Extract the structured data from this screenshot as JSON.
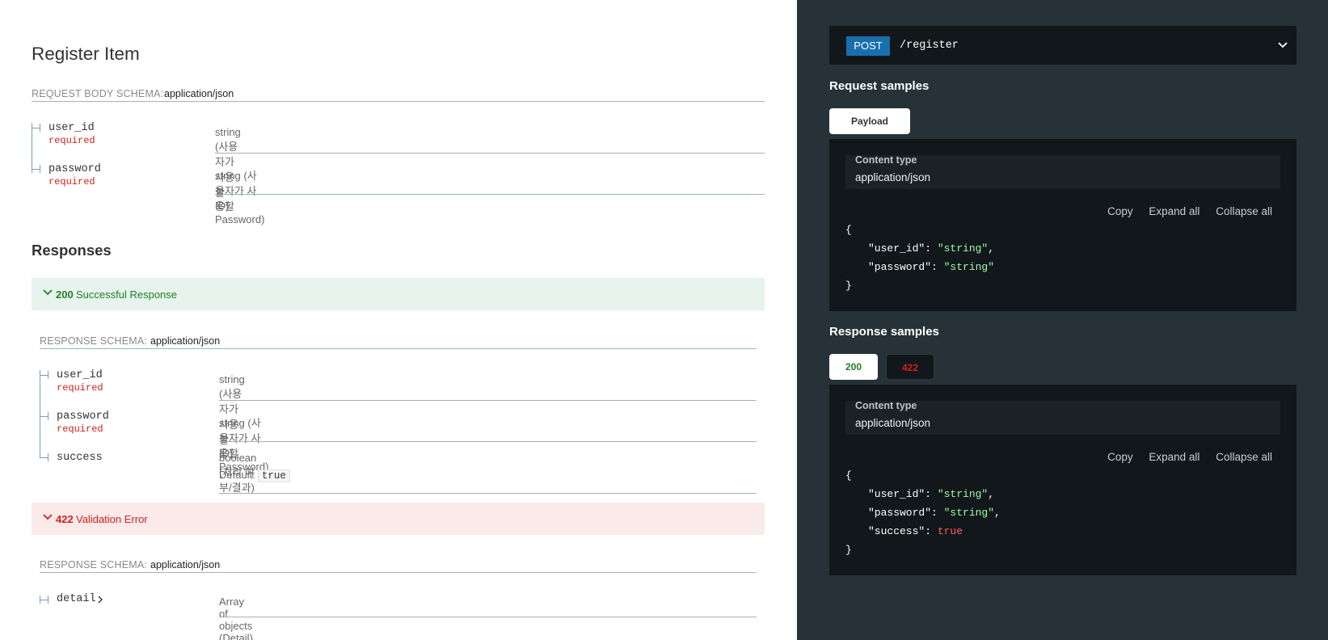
{
  "operation": {
    "title": "Register Item",
    "request_schema_label": "REQUEST BODY SCHEMA:",
    "request_schema_type": "application/json",
    "request_props": [
      {
        "name": "user_id",
        "required": "required",
        "desc": "string (사용자가 사용할 ID)"
      },
      {
        "name": "password",
        "required": "required",
        "desc": "string (사용자가 사용할 Password)"
      }
    ]
  },
  "responses": {
    "heading": "Responses",
    "ok": {
      "code": "200",
      "label": "Successful Response",
      "schema_label": "RESPONSE SCHEMA:",
      "schema_type": "application/json",
      "props": [
        {
          "name": "user_id",
          "required": "required",
          "desc": "string (사용자가 사용할 ID)"
        },
        {
          "name": "password",
          "required": "required",
          "desc": "string (사용자가 사용할 Password)"
        },
        {
          "name": "success",
          "desc": "boolean (처리 여부/결과)",
          "default_label": "Default:",
          "default_value": "true"
        }
      ]
    },
    "err": {
      "code": "422",
      "label": "Validation Error",
      "schema_label": "RESPONSE SCHEMA:",
      "schema_type": "application/json",
      "props": [
        {
          "name": "detail",
          "desc": "Array of objects (Detail)"
        }
      ]
    }
  },
  "panel": {
    "method": "POST",
    "path": "/register",
    "request_samples_title": "Request samples",
    "payload_tab": "Payload",
    "content_type_label": "Content type",
    "content_type_value": "application/json",
    "copy": "Copy",
    "expand_all": "Expand all",
    "collapse_all": "Collapse all",
    "response_samples_title": "Response samples",
    "tab_200": "200",
    "tab_422": "422",
    "request_json": {
      "open": "{",
      "close": "}",
      "k1": "\"user_id\"",
      "v1": "\"string\"",
      "k2": "\"password\"",
      "v2": "\"string\""
    },
    "response_json": {
      "open": "{",
      "close": "}",
      "k1": "\"user_id\"",
      "v1": "\"string\"",
      "k2": "\"password\"",
      "v2": "\"string\"",
      "k3": "\"success\"",
      "v3": "true"
    }
  },
  "colors": {
    "success": "#1d8127",
    "error": "#d41f1c",
    "post_method": "#186fae",
    "panel_bg": "#263238",
    "code_bg": "#11171a",
    "string_token": "#a0fbaa"
  }
}
